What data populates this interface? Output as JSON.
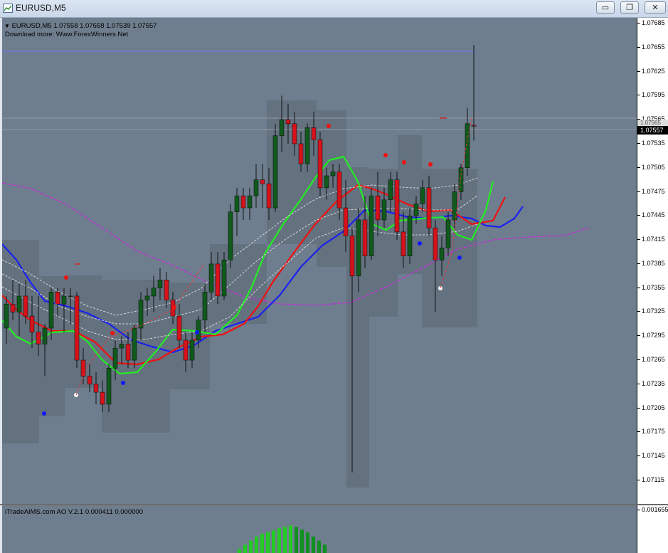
{
  "window": {
    "title": "EURUSD,M5",
    "minimize_glyph": "▭",
    "restore_glyph": "❐",
    "close_glyph": "✕"
  },
  "chart": {
    "symbol_info": "EURUSD,M5  1.07558 1.07658 1.07539 1.07557",
    "ad_text": "Download more: Www.ForexWinners.Net",
    "current_price": "1.07557",
    "overlay_price": "1.07565",
    "price_axis": [
      "1.07685",
      "1.07655",
      "1.07625",
      "1.07595",
      "1.07565",
      "1.07535",
      "1.07505",
      "1.07475",
      "1.07445",
      "1.07415",
      "1.07385",
      "1.07355",
      "1.07325",
      "1.07295",
      "1.07265",
      "1.07235",
      "1.07205",
      "1.07175",
      "1.07145",
      "1.07115"
    ]
  },
  "indicator": {
    "label": "iTradeAIMS.com AO V.2.1 0.000411 0.000000",
    "axis_top": "0.001655"
  },
  "colors": {
    "background": "#6f7e8e",
    "bull": "#0f5a1c",
    "bear": "#d8121b",
    "ma_green": "#22ee22",
    "ma_red": "#ee1111",
    "ma_blue": "#1a22ee",
    "ma_magenta": "#c030d8",
    "ao_bar": "#22cc22"
  },
  "icons": [
    "app-chart-icon",
    "minimize-icon",
    "restore-icon",
    "close-icon",
    "dropdown-triangle-icon"
  ],
  "chart_data": {
    "type": "candlestick",
    "symbol": "EURUSD",
    "timeframe": "M5",
    "ohlc_last": {
      "open": 1.07558,
      "high": 1.07658,
      "low": 1.07539,
      "close": 1.07557
    },
    "ylim": [
      1.0711,
      1.0769
    ],
    "candles": [
      [
        1.07305,
        1.07345,
        1.07285,
        1.07335
      ],
      [
        1.07335,
        1.07365,
        1.07315,
        1.07325
      ],
      [
        1.07325,
        1.0736,
        1.07295,
        1.07345
      ],
      [
        1.07345,
        1.07365,
        1.0731,
        1.0732
      ],
      [
        1.0732,
        1.07345,
        1.0728,
        1.073
      ],
      [
        1.073,
        1.07345,
        1.0727,
        1.07285
      ],
      [
        1.07285,
        1.0731,
        1.07245,
        1.07305
      ],
      [
        1.07305,
        1.07355,
        1.0729,
        1.0735
      ],
      [
        1.0735,
        1.07355,
        1.0732,
        1.07335
      ],
      [
        1.07335,
        1.07355,
        1.073,
        1.07345
      ],
      [
        1.07345,
        1.07355,
        1.0731,
        1.07345
      ],
      [
        1.07345,
        1.0735,
        1.07255,
        1.07265
      ],
      [
        1.07265,
        1.0728,
        1.07235,
        1.07245
      ],
      [
        1.07245,
        1.0726,
        1.07225,
        1.07235
      ],
      [
        1.07235,
        1.0725,
        1.0721,
        1.07225
      ],
      [
        1.07225,
        1.0724,
        1.072,
        1.0721
      ],
      [
        1.0721,
        1.0726,
        1.072,
        1.07255
      ],
      [
        1.07255,
        1.0729,
        1.0724,
        1.0728
      ],
      [
        1.0728,
        1.07295,
        1.0726,
        1.07285
      ],
      [
        1.07285,
        1.073,
        1.07255,
        1.07265
      ],
      [
        1.07265,
        1.0731,
        1.07255,
        1.07305
      ],
      [
        1.07305,
        1.0735,
        1.0729,
        1.0734
      ],
      [
        1.0734,
        1.07355,
        1.0732,
        1.07345
      ],
      [
        1.07345,
        1.0737,
        1.07325,
        1.07355
      ],
      [
        1.07355,
        1.0738,
        1.0734,
        1.07365
      ],
      [
        1.07365,
        1.07375,
        1.0733,
        1.0734
      ],
      [
        1.0734,
        1.0735,
        1.0731,
        1.0732
      ],
      [
        1.0732,
        1.07335,
        1.0728,
        1.0729
      ],
      [
        1.0729,
        1.073,
        1.0725,
        1.07265
      ],
      [
        1.07265,
        1.073,
        1.07255,
        1.0729
      ],
      [
        1.0729,
        1.0732,
        1.0728,
        1.07315
      ],
      [
        1.07315,
        1.0736,
        1.073,
        1.0735
      ],
      [
        1.0735,
        1.074,
        1.0734,
        1.07385
      ],
      [
        1.07385,
        1.074,
        1.07335,
        1.07345
      ],
      [
        1.07345,
        1.074,
        1.0734,
        1.0739
      ],
      [
        1.0739,
        1.0746,
        1.0738,
        1.0745
      ],
      [
        1.0745,
        1.0748,
        1.0742,
        1.0747
      ],
      [
        1.0747,
        1.0748,
        1.0744,
        1.07455
      ],
      [
        1.07455,
        1.0748,
        1.0744,
        1.0747
      ],
      [
        1.0747,
        1.0751,
        1.07455,
        1.0749
      ],
      [
        1.0749,
        1.0751,
        1.07455,
        1.07485
      ],
      [
        1.07485,
        1.07505,
        1.0744,
        1.07455
      ],
      [
        1.07455,
        1.0756,
        1.0745,
        1.07545
      ],
      [
        1.07545,
        1.07595,
        1.07525,
        1.07565
      ],
      [
        1.07565,
        1.07585,
        1.07535,
        1.0756
      ],
      [
        1.0756,
        1.07575,
        1.0752,
        1.07535
      ],
      [
        1.07535,
        1.0755,
        1.075,
        1.0751
      ],
      [
        1.0751,
        1.0756,
        1.075,
        1.07555
      ],
      [
        1.07555,
        1.07575,
        1.0752,
        1.0754
      ],
      [
        1.0754,
        1.0755,
        1.0747,
        1.0748
      ],
      [
        1.0748,
        1.07505,
        1.07465,
        1.07495
      ],
      [
        1.07495,
        1.0751,
        1.0748,
        1.075
      ],
      [
        1.075,
        1.0751,
        1.0744,
        1.07455
      ],
      [
        1.07455,
        1.0749,
        1.074,
        1.0742
      ],
      [
        1.0742,
        1.0743,
        1.07125,
        1.0737
      ],
      [
        1.0737,
        1.07455,
        1.0735,
        1.0744
      ],
      [
        1.0744,
        1.0747,
        1.0738,
        1.07395
      ],
      [
        1.07395,
        1.0748,
        1.0739,
        1.0747
      ],
      [
        1.0747,
        1.075,
        1.0742,
        1.0744
      ],
      [
        1.0744,
        1.0748,
        1.0743,
        1.07465
      ],
      [
        1.07465,
        1.075,
        1.0745,
        1.0749
      ],
      [
        1.0749,
        1.075,
        1.07415,
        1.07425
      ],
      [
        1.07425,
        1.0745,
        1.0738,
        1.07395
      ],
      [
        1.07395,
        1.07455,
        1.07385,
        1.07445
      ],
      [
        1.07445,
        1.0747,
        1.07435,
        1.0746
      ],
      [
        1.0746,
        1.0749,
        1.0745,
        1.0748
      ],
      [
        1.0748,
        1.07495,
        1.0742,
        1.0743
      ],
      [
        1.0743,
        1.0744,
        1.07325,
        1.0739
      ],
      [
        1.0739,
        1.0742,
        1.0737,
        1.07405
      ],
      [
        1.07405,
        1.0745,
        1.07395,
        1.0744
      ],
      [
        1.0744,
        1.07485,
        1.0743,
        1.07475
      ],
      [
        1.07475,
        1.0751,
        1.07465,
        1.07505
      ],
      [
        1.07505,
        1.0758,
        1.07495,
        1.0756
      ],
      [
        1.07558,
        1.07658,
        1.07539,
        1.07557
      ]
    ],
    "ao_values": [
      0.00015,
      0.0003,
      0.00045,
      0.0006,
      0.0007,
      0.00075,
      0.00082,
      0.0009,
      0.00095,
      0.001,
      0.00095,
      0.00085,
      0.00075,
      0.0006,
      0.00045,
      0.0003
    ]
  }
}
